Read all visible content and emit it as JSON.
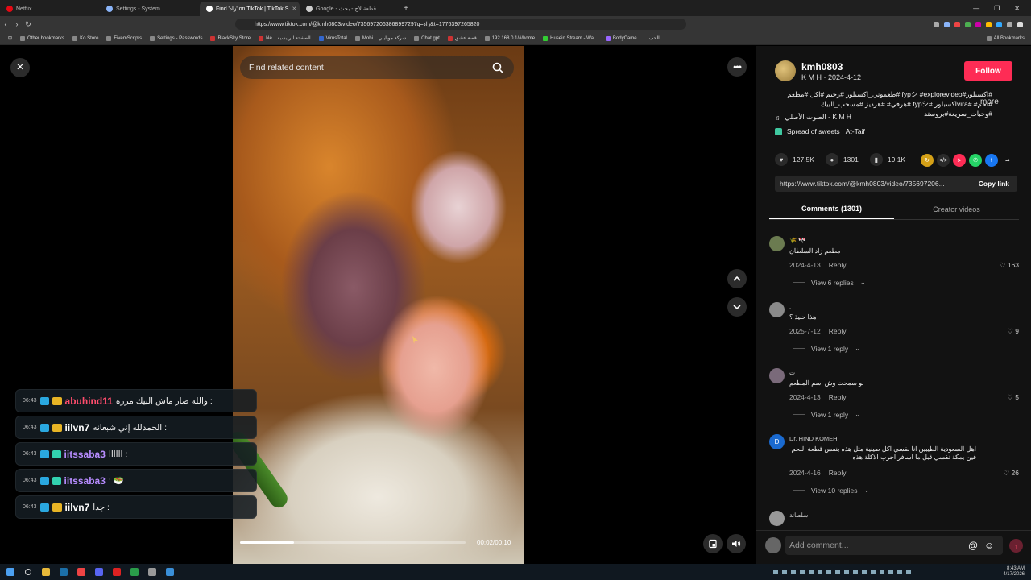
{
  "browser": {
    "tabs": [
      {
        "title": "Netflix",
        "color": "#e50914",
        "active": false
      },
      {
        "title": "Settings - System",
        "color": "#8ab4f8",
        "active": false
      },
      {
        "title": "Find 'زاد' on TikTok | TikTok S",
        "color": "#ffffff",
        "active": true
      },
      {
        "title": "Google - قطعة لاج - بحث",
        "color": "#cccccc",
        "active": false
      }
    ],
    "url": "https://www.tiktok.com/@kmh0803/video/7356972063868997297q=زاد&t=1776397265820",
    "bookmarks": [
      "Other bookmarks",
      "Ko Store",
      "FivemScripts",
      "Settings - Passwords",
      "BlackSky Store",
      "Ne... الصفحة الرئيسية",
      "VirusTotal",
      "Mobi... شركة موبايلي",
      "Chat gpt",
      "قصة عشق",
      "192.168.0.1/#/home",
      "Husein Stream - Wa...",
      "BodyCame...",
      "الحب"
    ],
    "all_bookmarks": "All Bookmarks"
  },
  "player": {
    "close_icon": "×",
    "search_placeholder": "Find related content",
    "more_label": "•••",
    "timecode": "00:02/00:10",
    "progress": 0.24
  },
  "chat": [
    {
      "time": "06:43",
      "user": "abuhind11",
      "user_color": "#ff4d6d",
      "message": "والله صار ماش البيك مرره :"
    },
    {
      "time": "06:43",
      "user": "iilvn7",
      "user_color": "#ffffff",
      "message": "الحمدلله إني شبعانه :"
    },
    {
      "time": "06:43",
      "user": "iitssaba3",
      "user_color": "#b78cff",
      "message": "اااااا :"
    },
    {
      "time": "06:43",
      "user": "iitssaba3",
      "user_color": "#b78cff",
      "message": ": 🥗"
    },
    {
      "time": "06:43",
      "user": "iilvn7",
      "user_color": "#ffffff",
      "message": "جدا :"
    }
  ],
  "panel": {
    "username": "kmh0803",
    "subline": "K M H · 2024-4-12",
    "follow_label": "Follow",
    "description": "#اكسبلور#fypシ #explorevideo #طعموني_اكسبلور #رجيم #اكل #مطعم #لحم# #viraاكسبلور #fypシ #هرفي# #هرديز #مسحب_البيك #وجبات_سريعة#بروستد",
    "more_label": "more",
    "sound": "الصوت الأصلي - K M H",
    "location": "Spread of sweets · At-Taif",
    "likes": "127.5K",
    "comments_count": "1301",
    "saves": "19.1K",
    "link": "https://www.tiktok.com/@kmh0803/video/735697206...",
    "copy_label": "Copy link",
    "tab_comments": "Comments (1301)",
    "tab_creator": "Creator videos",
    "add_comment_placeholder": "Add comment..."
  },
  "comments": [
    {
      "name": "🌾 🎌",
      "text": "مطعم زاد السلطان",
      "date": "2024-4-13",
      "reply": "Reply",
      "likes": "163",
      "replies": "View 6 replies",
      "initial": ""
    },
    {
      "name": ".",
      "text": "هذا حنيذ ؟",
      "date": "2025-7-12",
      "reply": "Reply",
      "likes": "9",
      "replies": "View 1 reply",
      "initial": ""
    },
    {
      "name": "ﺕ",
      "text": "لو سمحت وش اسم المطعم",
      "date": "2024-4-13",
      "reply": "Reply",
      "likes": "5",
      "replies": "View 1 reply",
      "initial": ""
    },
    {
      "name": "Dr. HIND KOMEH",
      "text": "اهل السعودية الطيبين انا نفسي اكل صينية مثل هذه بنفس قطعة اللحم فين بمكة نفسي قبل ما اسافر اجرب الاكلة هذه",
      "date": "2024-4-16",
      "reply": "Reply",
      "likes": "26",
      "replies": "View 10 replies",
      "initial": "D"
    },
    {
      "name": "سلطانة",
      "text": "",
      "date": "",
      "reply": "",
      "likes": "",
      "replies": "",
      "initial": ""
    }
  ],
  "taskbar": {
    "time": "8:43 AM",
    "date": "4/17/2026"
  }
}
